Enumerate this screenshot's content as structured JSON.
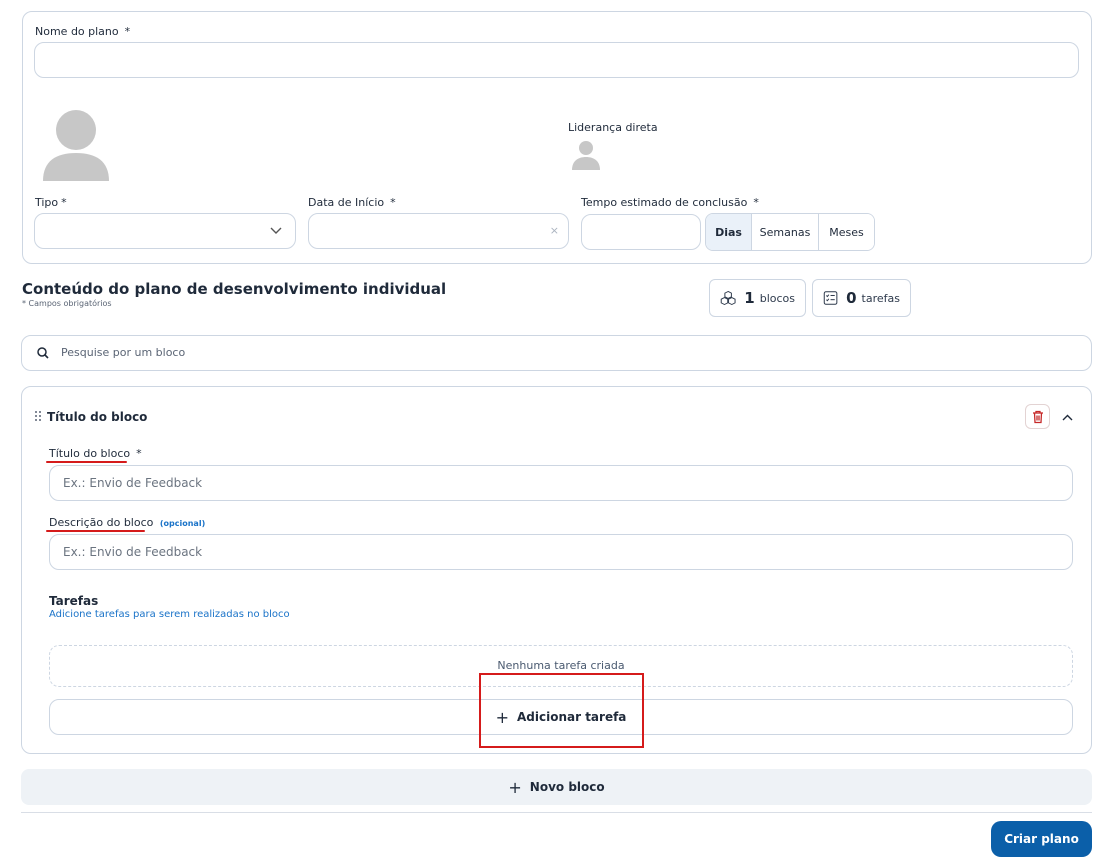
{
  "top": {
    "plan_name_label": "Nome do plano",
    "required_mark": "*",
    "leadership_label": "Liderança direta",
    "type_label": "Tipo",
    "start_date_label": "Data de Início",
    "estimated_time_label": "Tempo estimado de conclusão",
    "clear_glyph": "×",
    "units": [
      "Dias",
      "Semanas",
      "Meses"
    ],
    "selected_unit": "Dias"
  },
  "content": {
    "title": "Conteúdo do plano de desenvolvimento individual",
    "required_note": "* Campos obrigatórios",
    "blocks_count": "1",
    "blocks_label": "blocos",
    "tasks_count": "0",
    "tasks_label": "tarefas",
    "search_placeholder": "Pesquise por um bloco"
  },
  "block": {
    "header_title": "Título do bloco",
    "title_label": "Título do bloco",
    "title_placeholder": "Ex.: Envio de Feedback",
    "description_label": "Descrição do bloco",
    "optional_label": "(opcional)",
    "description_placeholder": "Ex.: Envio de Feedback",
    "tasks_heading": "Tarefas",
    "tasks_subtitle": "Adicione tarefas para serem realizadas no bloco",
    "empty_tasks": "Nenhuma tarefa criada",
    "add_task_label": "Adicionar tarefa"
  },
  "actions": {
    "new_block_label": "Novo bloco",
    "create_plan_label": "Criar plano"
  },
  "colors": {
    "primary": "#0b5fa9",
    "annotation_red": "#d51b1b",
    "delete_red": "#c62828",
    "optional_blue": "#1a73c8"
  }
}
